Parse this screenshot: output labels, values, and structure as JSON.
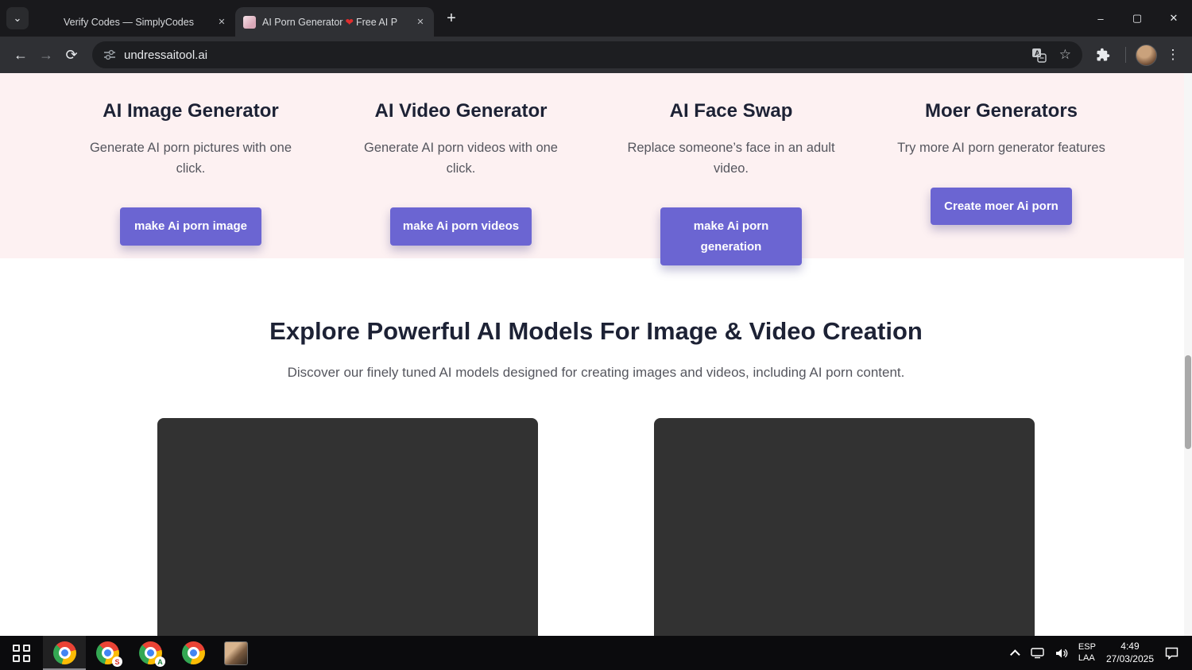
{
  "browser": {
    "tab1": {
      "title": "Verify Codes — SimplyCodes"
    },
    "tab2": {
      "title_before": "AI Porn Generator",
      "heart": "❤",
      "title_after": "Free AI P"
    },
    "url": "undressaitool.ai"
  },
  "icons": {
    "tab_search": "⌄",
    "close_tab": "✕",
    "new_tab": "+",
    "minimize": "–",
    "maximize": "▢",
    "close_window": "✕",
    "back": "←",
    "forward": "→",
    "reload": "⟳",
    "star": "☆",
    "menu_dots": "⋮"
  },
  "features": {
    "columns": [
      {
        "title": "AI Image Generator",
        "description": "Generate AI porn pictures with one click.",
        "button": "make Ai porn image"
      },
      {
        "title": "AI Video Generator",
        "description": "Generate AI porn videos with one click.",
        "button": "make Ai porn videos"
      },
      {
        "title": "AI Face Swap",
        "description": "Replace someone’s face in an adult video.",
        "button": "make Ai porn generation"
      },
      {
        "title": "Moer Generators",
        "description": "Try more AI porn generator features",
        "button": "Create moer Ai porn"
      }
    ]
  },
  "models": {
    "heading": "Explore Powerful AI Models For Image & Video Creation",
    "subtitle": "Discover our finely tuned AI models designed for creating images and videos, including AI porn content."
  },
  "taskbar": {
    "badge_s": "S",
    "badge_a": "A",
    "lang_line1": "ESP",
    "lang_line2": "LAA",
    "time": "4:49",
    "date": "27/03/2025"
  },
  "colors": {
    "accent_purple": "#6b65d2",
    "pink_background": "#fdf1f2",
    "heading_navy": "#1d2235",
    "dark_card": "#323232"
  }
}
